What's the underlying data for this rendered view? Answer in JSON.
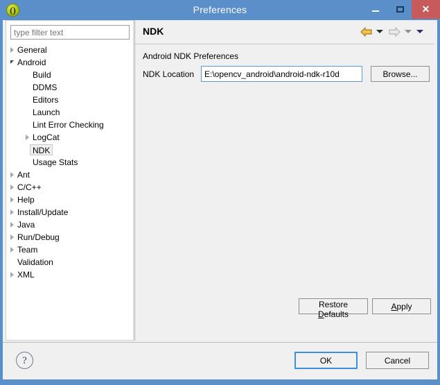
{
  "window": {
    "title": "Preferences",
    "icon": "eclipse-parens-icon",
    "controls": {
      "minimize": "minimize-icon",
      "maximize": "maximize-icon",
      "close": "✕"
    },
    "titlebar_color": "#5b8fc9",
    "close_button_color": "#c75b5b"
  },
  "filter": {
    "placeholder": "type filter text",
    "value": ""
  },
  "tree": {
    "items": [
      {
        "label": "General",
        "indent": 0,
        "twisty": "collapsed",
        "selected": false
      },
      {
        "label": "Android",
        "indent": 0,
        "twisty": "expanded",
        "selected": false
      },
      {
        "label": "Build",
        "indent": 1,
        "twisty": "none",
        "selected": false
      },
      {
        "label": "DDMS",
        "indent": 1,
        "twisty": "none",
        "selected": false
      },
      {
        "label": "Editors",
        "indent": 1,
        "twisty": "none",
        "selected": false
      },
      {
        "label": "Launch",
        "indent": 1,
        "twisty": "none",
        "selected": false
      },
      {
        "label": "Lint Error Checking",
        "indent": 1,
        "twisty": "none",
        "selected": false
      },
      {
        "label": "LogCat",
        "indent": 1,
        "twisty": "collapsed",
        "selected": false
      },
      {
        "label": "NDK",
        "indent": 1,
        "twisty": "none",
        "selected": true
      },
      {
        "label": "Usage Stats",
        "indent": 1,
        "twisty": "none",
        "selected": false
      },
      {
        "label": "Ant",
        "indent": 0,
        "twisty": "collapsed",
        "selected": false
      },
      {
        "label": "C/C++",
        "indent": 0,
        "twisty": "collapsed",
        "selected": false
      },
      {
        "label": "Help",
        "indent": 0,
        "twisty": "collapsed",
        "selected": false
      },
      {
        "label": "Install/Update",
        "indent": 0,
        "twisty": "collapsed",
        "selected": false
      },
      {
        "label": "Java",
        "indent": 0,
        "twisty": "collapsed",
        "selected": false
      },
      {
        "label": "Run/Debug",
        "indent": 0,
        "twisty": "collapsed",
        "selected": false
      },
      {
        "label": "Team",
        "indent": 0,
        "twisty": "collapsed",
        "selected": false
      },
      {
        "label": "Validation",
        "indent": 0,
        "twisty": "none",
        "selected": false
      },
      {
        "label": "XML",
        "indent": 0,
        "twisty": "collapsed",
        "selected": false
      }
    ]
  },
  "page": {
    "title": "NDK",
    "section_label": "Android NDK Preferences",
    "ndk_location_label": "NDK Location",
    "ndk_location_value": "E:\\opencv_android\\android-ndk-r10d",
    "ndk_location_placeholder": "",
    "browse_label": "Browse...",
    "nav": {
      "back": "back-arrow-icon",
      "back_menu": "chevron-down-icon",
      "forward": "forward-arrow-icon",
      "forward_menu": "chevron-down-icon",
      "dropdown": "chevron-down-icon",
      "back_color": "#e0a53a",
      "forward_color": "#d8d8d8"
    }
  },
  "page_buttons": {
    "restore_defaults_pre": "Restore ",
    "restore_defaults_key": "D",
    "restore_defaults_post": "efaults",
    "apply_key": "A",
    "apply_post": "pply"
  },
  "dialog_buttons": {
    "help": "?",
    "ok": "OK",
    "cancel": "Cancel",
    "ok_focus_color": "#3c8fdb"
  }
}
